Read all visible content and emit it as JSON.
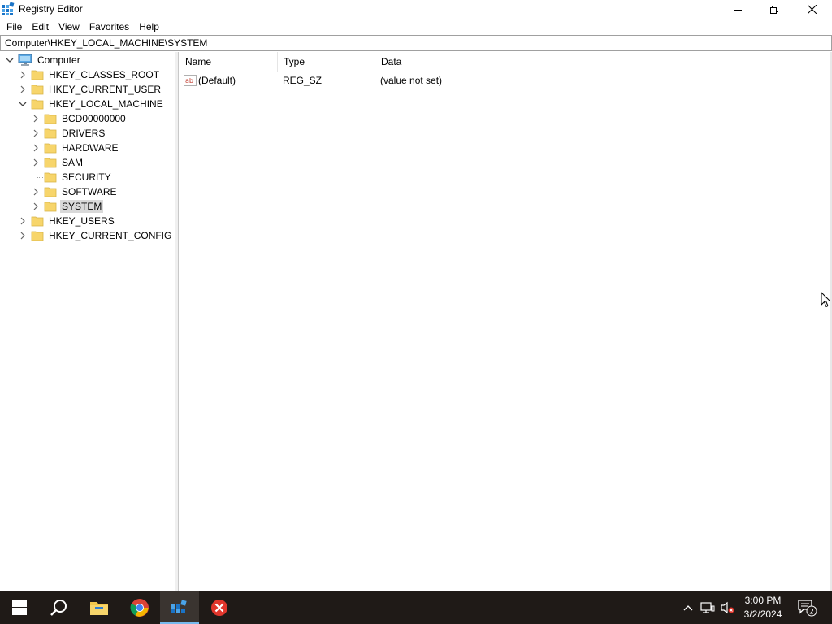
{
  "window": {
    "title": "Registry Editor"
  },
  "menu": [
    "File",
    "Edit",
    "View",
    "Favorites",
    "Help"
  ],
  "address": "Computer\\HKEY_LOCAL_MACHINE\\SYSTEM",
  "tree": {
    "root": "Computer",
    "hives": [
      "HKEY_CLASSES_ROOT",
      "HKEY_CURRENT_USER",
      "HKEY_LOCAL_MACHINE",
      "HKEY_USERS",
      "HKEY_CURRENT_CONFIG"
    ],
    "hklm_children": [
      "BCD00000000",
      "DRIVERS",
      "HARDWARE",
      "SAM",
      "SECURITY",
      "SOFTWARE",
      "SYSTEM"
    ],
    "selected": "SYSTEM"
  },
  "list": {
    "columns": [
      "Name",
      "Type",
      "Data"
    ],
    "rows": [
      {
        "name": "(Default)",
        "type": "REG_SZ",
        "data": "(value not set)",
        "icon": "string-value-icon"
      }
    ]
  },
  "taskbar": {
    "apps": [
      "start",
      "search",
      "file-explorer",
      "chrome",
      "registry-editor",
      "app-error"
    ],
    "active_app": "registry-editor",
    "time": "3:00 PM",
    "date": "3/2/2024",
    "notification_count": "2"
  },
  "colors": {
    "taskbar_bg": "#1f1a17",
    "folder": "#f7d56b",
    "selection": "#d9d9d9",
    "accent": "#76b9ed"
  }
}
